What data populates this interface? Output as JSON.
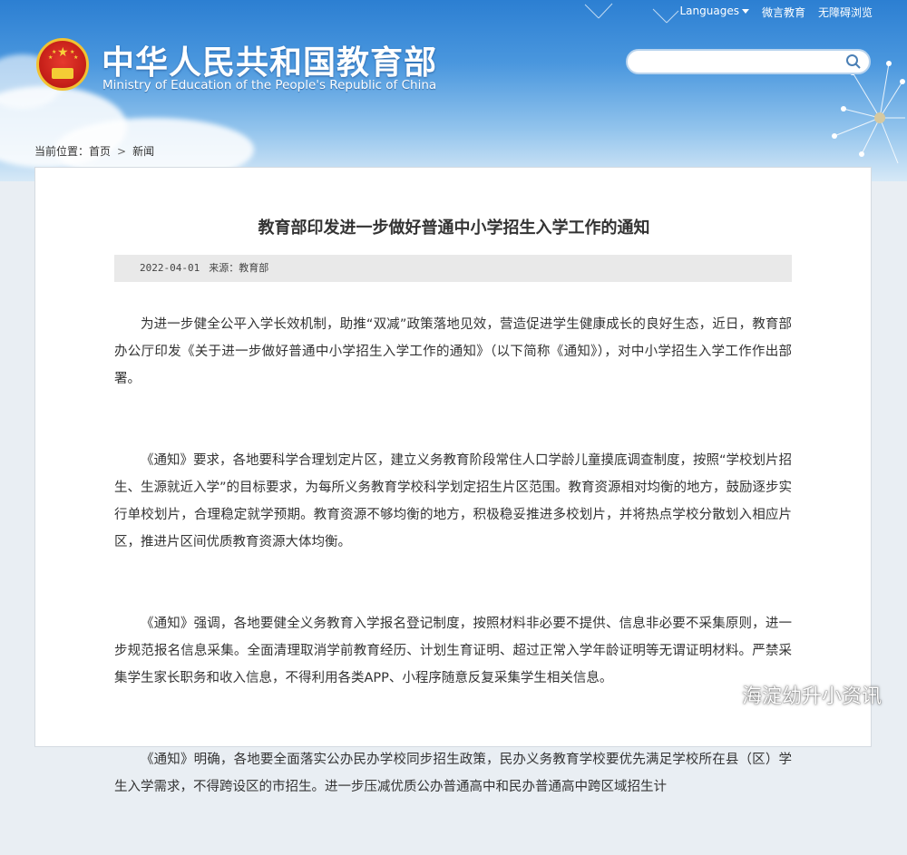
{
  "header": {
    "site_title": "中华人民共和国教育部",
    "site_subtitle": "Ministry of Education of the People's Republic of China",
    "links": {
      "languages": "Languages",
      "weibo": "微言教育",
      "accessibility": "无障碍浏览"
    },
    "search_placeholder": ""
  },
  "breadcrumb": {
    "prefix": "当前位置：",
    "home": "首页",
    "separator": ">",
    "current": "新闻"
  },
  "article": {
    "title": "教育部印发进一步做好普通中小学招生入学工作的通知",
    "date": "2022-04-01",
    "source": "来源：教育部",
    "paragraphs": [
      "为进一步健全公平入学长效机制，助推“双减”政策落地见效，营造促进学生健康成长的良好生态，近日，教育部办公厅印发《关于进一步做好普通中小学招生入学工作的通知》（以下简称《通知》），对中小学招生入学工作作出部署。",
      "《通知》要求，各地要科学合理划定片区，建立义务教育阶段常住人口学龄儿童摸底调查制度，按照“学校划片招生、生源就近入学”的目标要求，为每所义务教育学校科学划定招生片区范围。教育资源相对均衡的地方，鼓励逐步实行单校划片，合理稳定就学预期。教育资源不够均衡的地方，积极稳妥推进多校划片，并将热点学校分散划入相应片区，推进片区间优质教育资源大体均衡。",
      "《通知》强调，各地要健全义务教育入学报名登记制度，按照材料非必要不提供、信息非必要不采集原则，进一步规范报名信息采集。全面清理取消学前教育经历、计划生育证明、超过正常入学年龄证明等无谓证明材料。严禁采集学生家长职务和收入信息，不得利用各类APP、小程序随意反复采集学生相关信息。",
      "《通知》明确，各地要全面落实公办民办学校同步招生政策，民办义务教育学校要优先满足学校所在县（区）学生入学需求，不得跨设区的市招生。进一步压减优质公办普通高中和民办普通高中跨区域招生计"
    ]
  },
  "watermark": "海淀幼升小资讯",
  "colors": {
    "sky_top": "#2c7fd2",
    "emblem_red": "#c8211a",
    "emblem_gold": "#f1c232",
    "meta_bg": "#e9e9e9"
  }
}
